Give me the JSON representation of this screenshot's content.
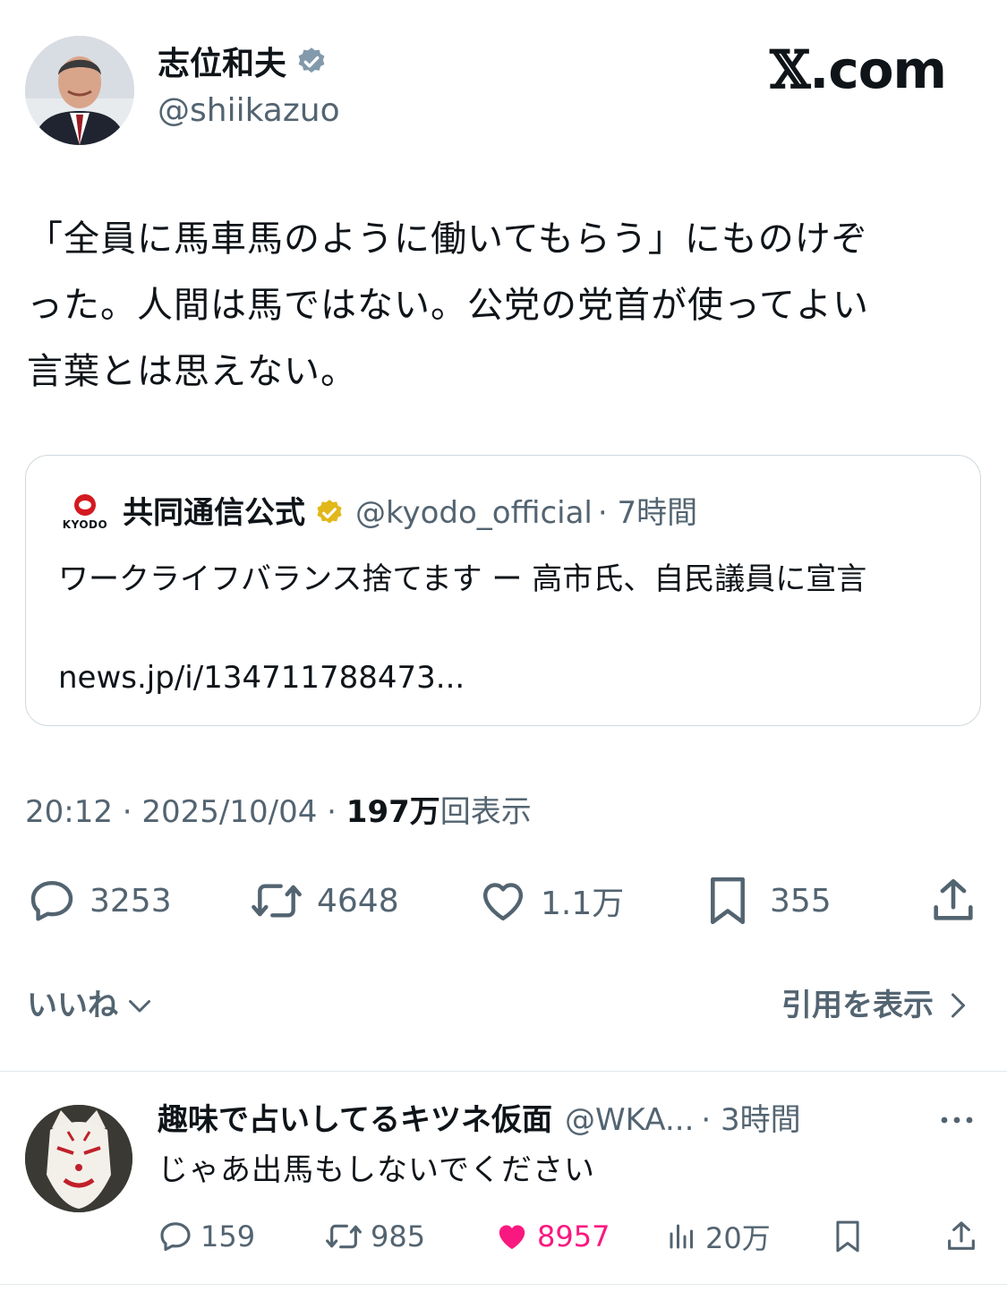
{
  "author": {
    "name": "志位和夫",
    "handle": "@shiikazuo",
    "verified_color": "#829aab"
  },
  "watermark": {
    "x": "𝕏",
    "rest": ".com"
  },
  "post": {
    "text": "「全員に馬車馬のように働いてもらう」にものけぞ\nった。人間は馬ではない。公党の党首が使ってよい\n言葉とは思えない。"
  },
  "quote": {
    "logo_text": "KYODO",
    "name": "共同通信公式",
    "verified_color": "#e2b719",
    "handle": "@kyodo_official",
    "time": "· 7時間",
    "text": "ワークライフバランス捨てます ー 高市氏、自民議員に宣言",
    "link": "news.jp/i/134711788473..."
  },
  "meta": {
    "time": "20:12 · 2025/10/04 · ",
    "views": "197万",
    "views_label": "回表示"
  },
  "actions": {
    "replies": "3253",
    "reposts": "4648",
    "likes": "1.1万",
    "bookmarks": "355"
  },
  "likes_toggle": "いいね",
  "quotes_link": "引用を表示",
  "reply": {
    "name": "趣味で占いしてるキツネ仮面",
    "handle": "@WKA...",
    "time": "· 3時間",
    "text": "じゃあ出馬もしないでください",
    "replies": "159",
    "reposts": "985",
    "likes": "8957",
    "views": "20万",
    "like_color": "#f91880"
  }
}
